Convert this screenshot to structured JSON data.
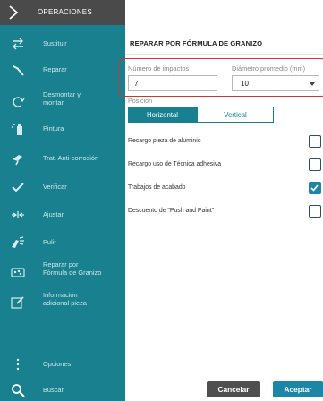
{
  "topbar": {
    "title": "OPERACIONES"
  },
  "sidebar": {
    "items": [
      {
        "label": "Sustituir",
        "icon": "swap-arrows-icon"
      },
      {
        "label": "Reparar",
        "icon": "hammer-icon"
      },
      {
        "label": "Desmontar y\nmontar",
        "icon": "refresh-icon"
      },
      {
        "label": "Pintura",
        "icon": "spray-icon"
      },
      {
        "label": "Trat. Anti-corrosión",
        "icon": "spray-gun-icon"
      },
      {
        "label": "Verificar",
        "icon": "checkmark-icon"
      },
      {
        "label": "Ajustar",
        "icon": "adjust-arrows-icon"
      },
      {
        "label": "Pulir",
        "icon": "polish-icon"
      },
      {
        "label": "Reparar por\nFórmula de Granizo",
        "icon": "hail-icon"
      },
      {
        "label": "Información\nadicional pieza",
        "icon": "edit-note-icon"
      }
    ],
    "options_label": "Opciones",
    "search_label": "Buscar"
  },
  "main": {
    "title": "REPARAR POR FÓRMULA DE GRANIZO",
    "impacts_label": "Número de impactos",
    "impacts_value": "7",
    "diameter_label": "Diámetro promedio (mm)",
    "diameter_value": "10",
    "position_label": "Posición",
    "position_options": [
      "Horizontal",
      "Vertical"
    ],
    "position_selected": "Horizontal",
    "options": [
      {
        "label": "Recargo pieza de aluminio",
        "checked": false
      },
      {
        "label": "Recargo uso de Técnica adhesiva",
        "checked": false
      },
      {
        "label": "Trabajos de acabado",
        "checked": true
      },
      {
        "label": "Descuento de \"Push and Paint\"",
        "checked": false
      }
    ],
    "cancel_label": "Cancelar",
    "accept_label": "Aceptar"
  },
  "colors": {
    "sidebar": "#18808e",
    "accent": "#1c86a6",
    "highlight": "#d0342c",
    "topbar": "#4a4a4a"
  }
}
